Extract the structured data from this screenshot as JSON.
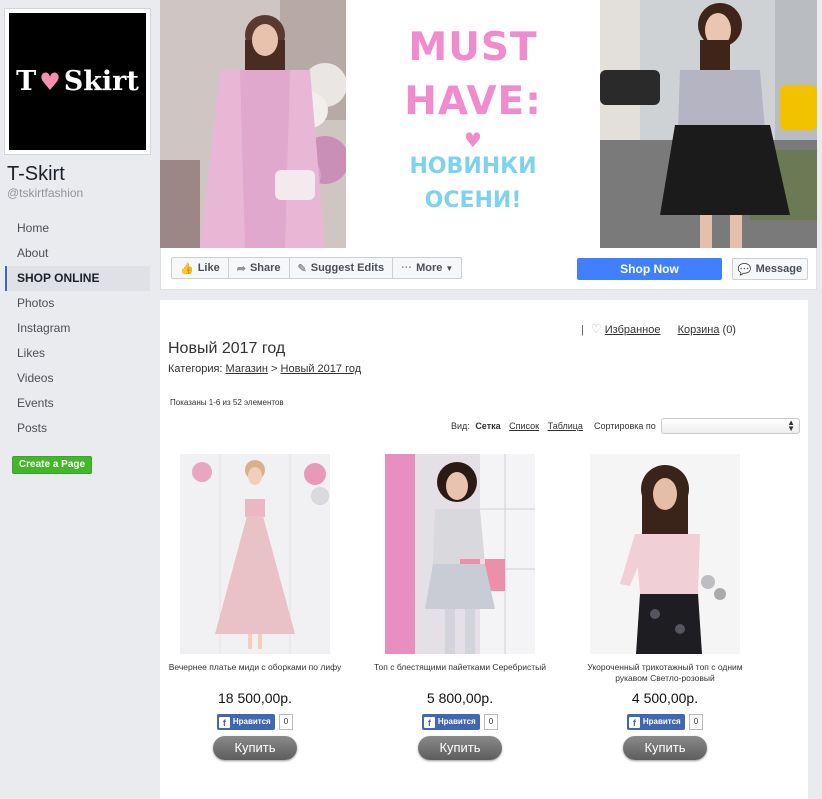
{
  "page": {
    "logo_text_left": "T",
    "logo_heart": "♥",
    "logo_text_right": "Skirt",
    "name": "T-Skirt",
    "handle": "@tskirtfashion"
  },
  "nav": {
    "items": [
      {
        "label": "Home"
      },
      {
        "label": "About"
      },
      {
        "label": "SHOP ONLINE"
      },
      {
        "label": "Photos"
      },
      {
        "label": "Instagram"
      },
      {
        "label": "Likes"
      },
      {
        "label": "Videos"
      },
      {
        "label": "Events"
      },
      {
        "label": "Posts"
      }
    ],
    "active_index": 2,
    "create_page": "Create a Page"
  },
  "cover": {
    "line1": "MUST",
    "line2": "HAVE:",
    "heart": "♥",
    "line3": "НОВИНКИ",
    "line4": "ОСЕНИ!"
  },
  "actions": {
    "like": "Like",
    "share": "Share",
    "suggest": "Suggest Edits",
    "more": "More",
    "shop_now": "Shop Now",
    "message": "Message"
  },
  "shop": {
    "sep": "|",
    "favorites": "Избранное",
    "cart_label": "Корзина",
    "cart_count": "(0)",
    "title": "Новый 2017 год",
    "category_label": "Категория:",
    "crumb_shop": "Магазин",
    "crumb_arrow": ">",
    "crumb_current": "Новый 2017 год",
    "shown": "Показаны 1-6 из 52 элементов",
    "view_label": "Вид:",
    "view_grid": "Сетка",
    "view_list": "Список",
    "view_table": "Таблица",
    "sort_label": "Сортировка по",
    "products": [
      {
        "name": "Вечернее платье миди с оборками по лифу",
        "price": "18 500,00р.",
        "like": "Нравится",
        "count": "0",
        "buy": "Купить"
      },
      {
        "name": "Топ с блестящими пайетками Серебристый",
        "price": "5 800,00р.",
        "like": "Нравится",
        "count": "0",
        "buy": "Купить"
      },
      {
        "name": "Укороченный трикотажный топ с одним рукавом Светло-розовый",
        "price": "4 500,00р.",
        "like": "Нравится",
        "count": "0",
        "buy": "Купить"
      }
    ]
  }
}
